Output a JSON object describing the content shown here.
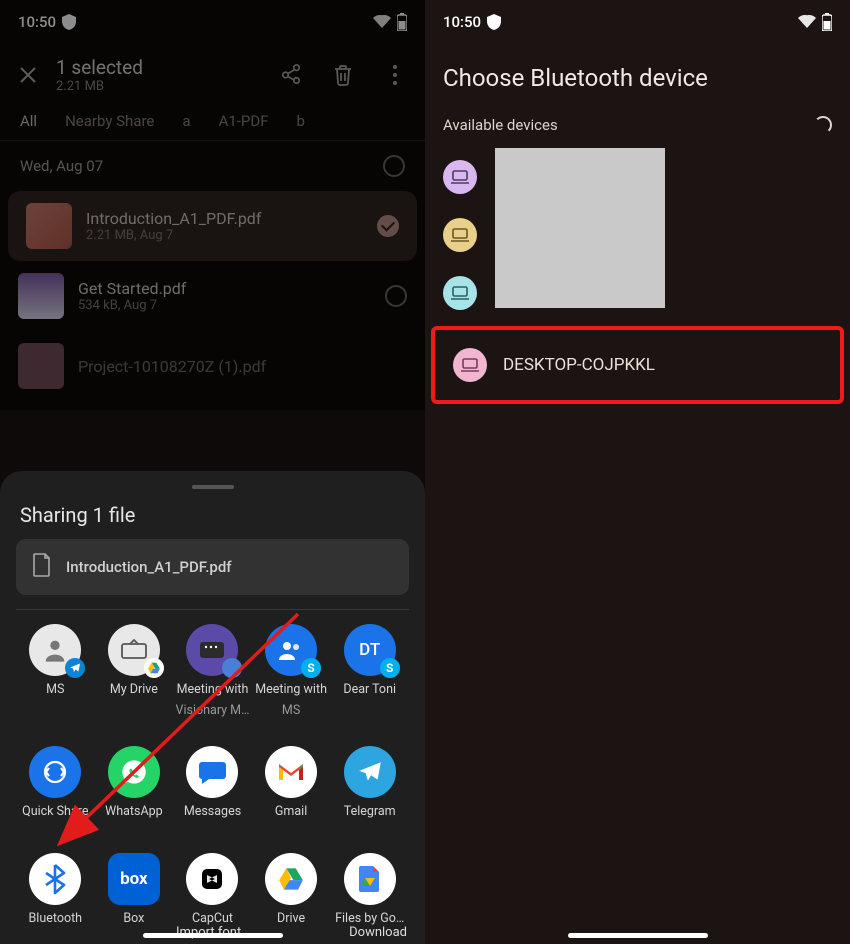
{
  "status": {
    "time": "10:50",
    "shield": "shield-icon",
    "wifi": "wifi-icon",
    "battery": "battery-icon"
  },
  "left": {
    "selection_title": "1 selected",
    "selection_size": "2.21 MB",
    "tabs": [
      "All",
      "Nearby Share",
      "a",
      "A1-PDF",
      "b"
    ],
    "date_header": "Wed, Aug 07",
    "files": [
      {
        "name": "Introduction_A1_PDF.pdf",
        "meta": "2.21 MB, Aug 7",
        "selected": true
      },
      {
        "name": "Get Started.pdf",
        "meta": "534 kB, Aug 7",
        "selected": false
      },
      {
        "name": "Project-10108270Z (1).pdf",
        "meta": "",
        "selected": false
      }
    ],
    "sheet": {
      "title": "Sharing 1 file",
      "filename": "Introduction_A1_PDF.pdf",
      "row1": [
        {
          "label": "MS",
          "sublabel": ""
        },
        {
          "label": "My Drive",
          "sublabel": ""
        },
        {
          "label": "Meeting with",
          "sublabel": "Visionary M…"
        },
        {
          "label": "Meeting with",
          "sublabel": "MS"
        },
        {
          "label": "Dear Toni",
          "sublabel": ""
        }
      ],
      "row2": [
        {
          "label": "Quick Share"
        },
        {
          "label": "WhatsApp"
        },
        {
          "label": "Messages"
        },
        {
          "label": "Gmail"
        },
        {
          "label": "Telegram"
        }
      ],
      "row3": [
        {
          "label": "Bluetooth"
        },
        {
          "label": "Box"
        },
        {
          "label": "CapCut"
        },
        {
          "label": "Drive"
        },
        {
          "label": "Files by Go…"
        }
      ],
      "import_font": "Import font",
      "download": "Download"
    }
  },
  "right": {
    "title": "Choose Bluetooth device",
    "subtitle": "Available devices",
    "highlighted_device": "DESKTOP-COJPKKL"
  }
}
